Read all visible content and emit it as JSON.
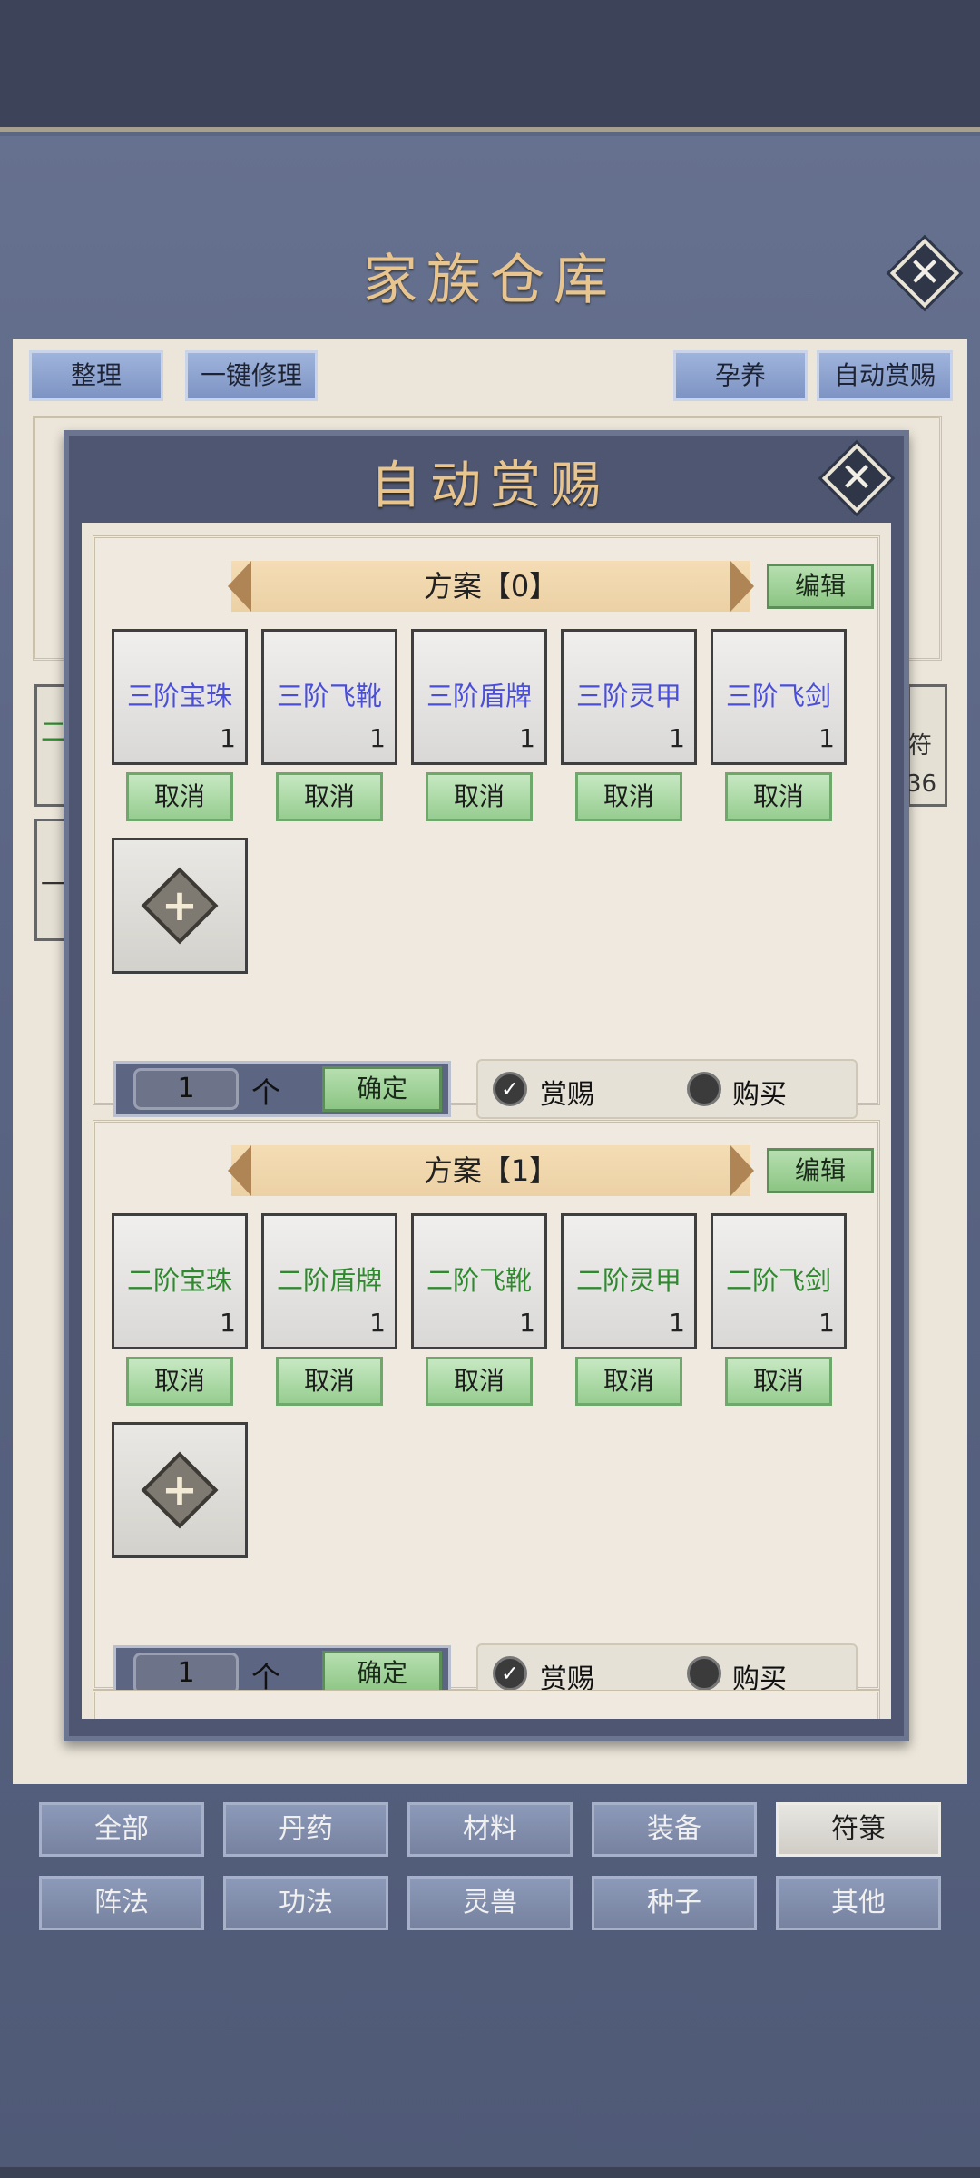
{
  "warehouse": {
    "title": "家族仓库",
    "buttons": {
      "sort": "整理",
      "repair": "一键修理",
      "breed": "孕养",
      "auto_reward": "自动赏赐"
    }
  },
  "dialog": {
    "title": "自动赏赐",
    "plans": [
      {
        "name": "方案【0】",
        "edit_label": "编辑",
        "items": [
          {
            "name": "三阶宝珠",
            "count": "1"
          },
          {
            "name": "三阶飞靴",
            "count": "1"
          },
          {
            "name": "三阶盾牌",
            "count": "1"
          },
          {
            "name": "三阶灵甲",
            "count": "1"
          },
          {
            "name": "三阶飞剑",
            "count": "1"
          }
        ],
        "cancel_label": "取消",
        "quantity": "1",
        "unit": "个",
        "confirm_label": "确定",
        "options": [
          {
            "label": "赏赐",
            "selected": true
          },
          {
            "label": "购买",
            "selected": false
          }
        ]
      },
      {
        "name": "方案【1】",
        "edit_label": "编辑",
        "items": [
          {
            "name": "二阶宝珠",
            "count": "1"
          },
          {
            "name": "二阶盾牌",
            "count": "1"
          },
          {
            "name": "二阶飞靴",
            "count": "1"
          },
          {
            "name": "二阶灵甲",
            "count": "1"
          },
          {
            "name": "二阶飞剑",
            "count": "1"
          }
        ],
        "cancel_label": "取消",
        "quantity": "1",
        "unit": "个",
        "confirm_label": "确定",
        "options": [
          {
            "label": "赏赐",
            "selected": true
          },
          {
            "label": "购买",
            "selected": false
          }
        ]
      }
    ]
  },
  "background_fragments": {
    "left_1": "二",
    "left_2": "一",
    "right_1": "符",
    "right_2": "36"
  },
  "tabs": {
    "row1": [
      "全部",
      "丹药",
      "材料",
      "装备",
      "符箓"
    ],
    "row2": [
      "阵法",
      "功法",
      "灵兽",
      "种子",
      "其他"
    ],
    "active": "符箓"
  },
  "colors": {
    "tier3_item": "#4b4fd8",
    "tier2_item": "#2f8a2f",
    "title_gold": "#e8c58e"
  }
}
